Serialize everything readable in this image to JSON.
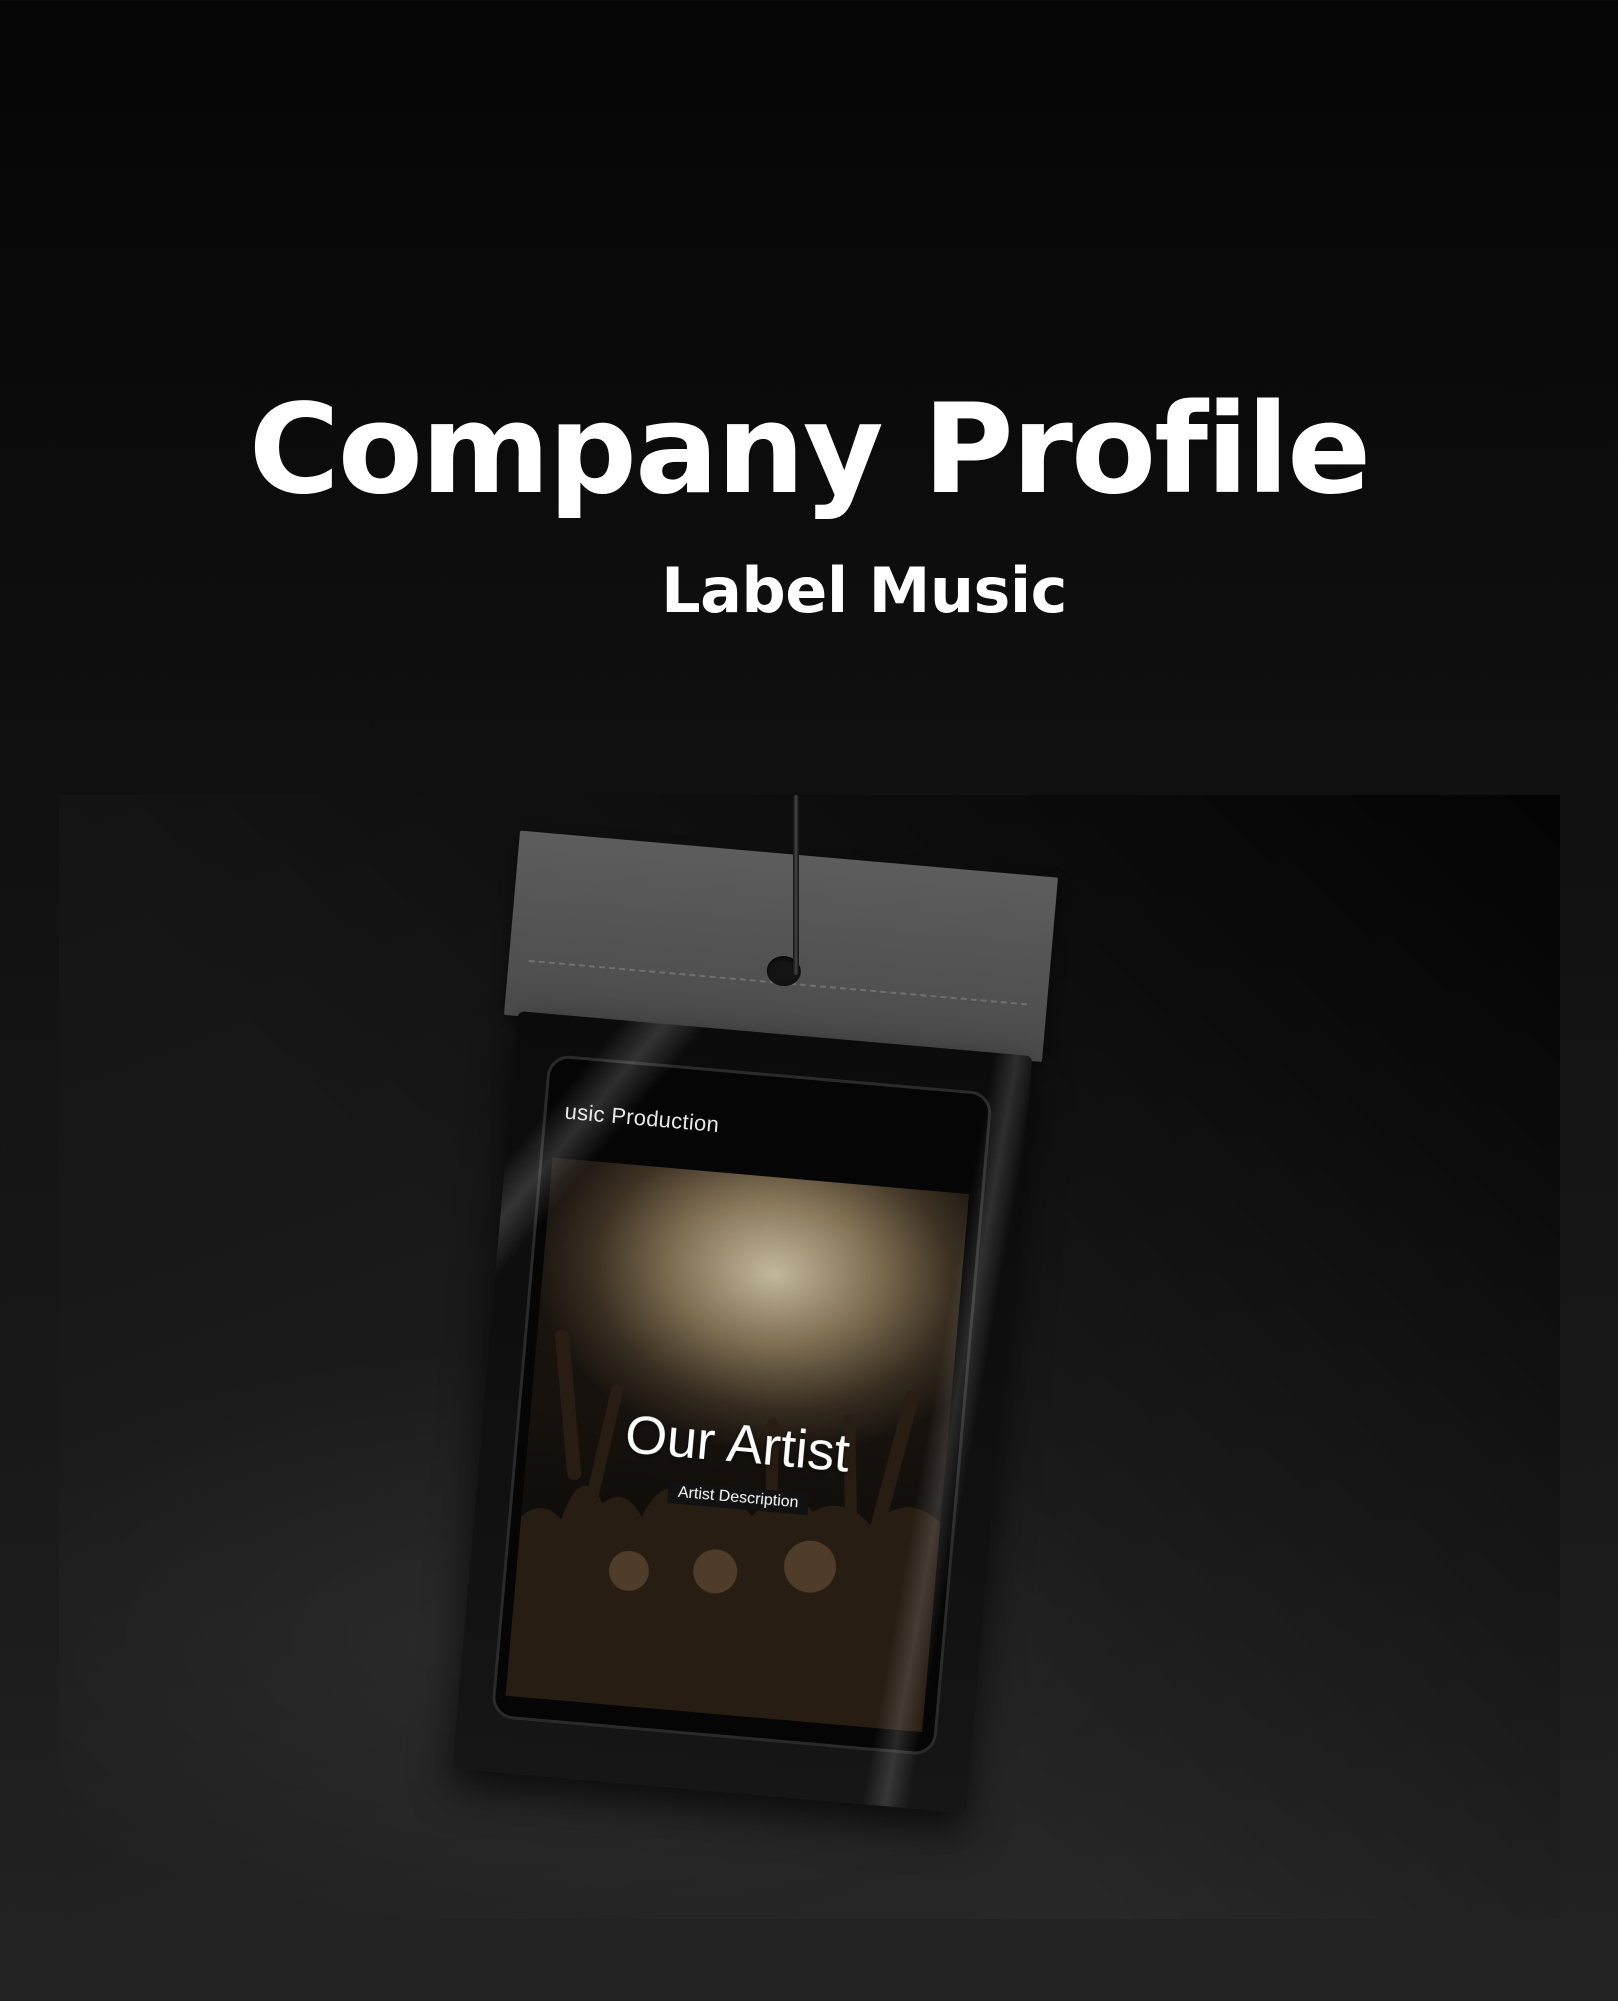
{
  "title": "Company Profile",
  "subtitle": "Label Music",
  "mockup": {
    "tablet_header": "usic Production",
    "hero_title": "Our Artist",
    "hero_description": "Artist Description"
  },
  "colors": {
    "background": "#0f0f0f",
    "text": "#ffffff",
    "header_card": "#555555",
    "pouch": "#0b0b0b"
  }
}
